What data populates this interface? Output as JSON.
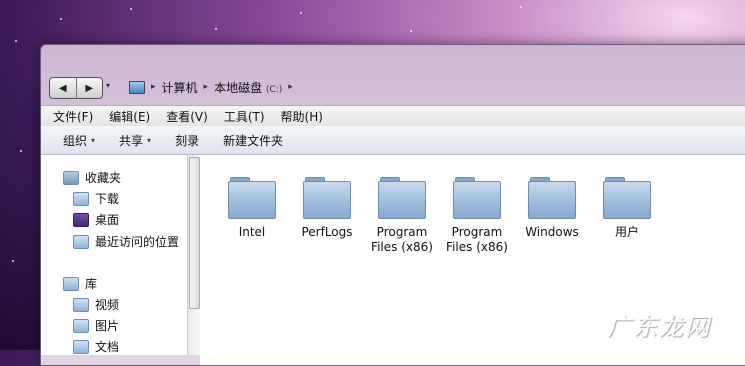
{
  "nav": {
    "back_label": "◀",
    "forward_label": "▶",
    "recent_label": "▾",
    "breadcrumb": [
      {
        "label": "计算机"
      },
      {
        "label": "本地磁盘"
      }
    ],
    "drive_letter": "(C:)"
  },
  "menubar": {
    "items": [
      "文件(F)",
      "编辑(E)",
      "查看(V)",
      "工具(T)",
      "帮助(H)"
    ]
  },
  "toolbar": {
    "organize": "组织",
    "share": "共享",
    "burn": "刻录",
    "new_folder": "新建文件夹"
  },
  "sidebar": {
    "favorites": "收藏夹",
    "downloads": "下载",
    "desktop": "桌面",
    "recent_places": "最近访问的位置",
    "libraries": "库",
    "videos": "视频",
    "pictures": "图片",
    "documents": "文档"
  },
  "folders": [
    {
      "line1": "Intel",
      "line2": ""
    },
    {
      "line1": "PerfLogs",
      "line2": ""
    },
    {
      "line1": "Program",
      "line2": "Files (x86)"
    },
    {
      "line1": "Program",
      "line2": "Files (x86)"
    },
    {
      "line1": "Windows",
      "line2": ""
    },
    {
      "line1": "用户",
      "line2": ""
    }
  ],
  "watermark": "广东龙网",
  "colors": {
    "folder_fill": "#9fbddd",
    "toolbar_bg": "#dfe5ed",
    "desktop_purple": "#3a1a55"
  }
}
